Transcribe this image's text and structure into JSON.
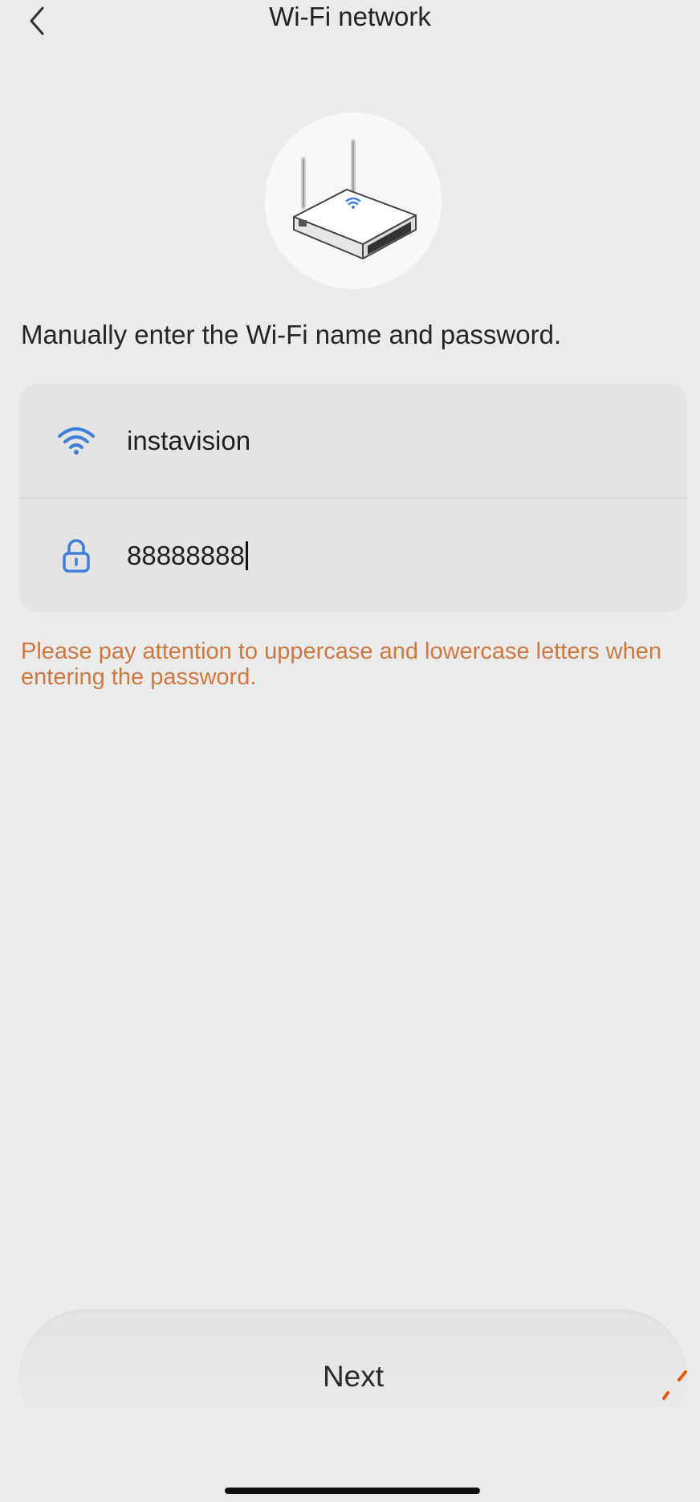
{
  "header": {
    "title": "Wi-Fi network",
    "back_icon": "chevron-left-icon"
  },
  "illustration": {
    "icon": "router-icon"
  },
  "instruction": "Manually enter the Wi-Fi name and password.",
  "form": {
    "ssid": {
      "icon": "wifi-icon",
      "value": "instavision"
    },
    "password": {
      "icon": "lock-icon",
      "value": "88888888"
    }
  },
  "hint": "Please pay attention to uppercase and lowercase letters when entering the password.",
  "next_label": "Next",
  "colors": {
    "background": "#ebebeb",
    "accent_blue": "#3f7fd8",
    "hint_orange": "#d1783f"
  }
}
